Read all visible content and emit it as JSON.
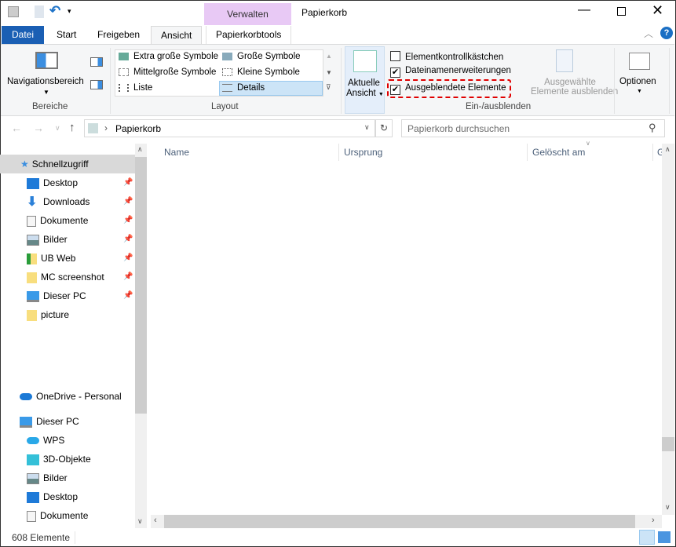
{
  "title": "Papierkorb",
  "context_tab": "Verwalten",
  "tabs": [
    {
      "label": "Datei"
    },
    {
      "label": "Start"
    },
    {
      "label": "Freigeben"
    },
    {
      "label": "Ansicht"
    },
    {
      "label": "Papierkorbtools"
    }
  ],
  "ribbon": {
    "bereiche": {
      "nav_label": "Navigationsbereich",
      "group": "Bereiche"
    },
    "layout": {
      "items": [
        "Extra große Symbole",
        "Große Symbole",
        "Mittelgroße Symbole",
        "Kleine Symbole",
        "Liste",
        "Details"
      ],
      "selected": "Details",
      "group": "Layout"
    },
    "current_view": {
      "line1": "Aktuelle",
      "line2": "Ansicht"
    },
    "show_hide": {
      "checkboxes": [
        {
          "label": "Elementkontrollkästchen",
          "checked": false
        },
        {
          "label": "Dateinamenerweiterungen",
          "checked": true
        },
        {
          "label": "Ausgeblendete Elemente",
          "checked": true
        }
      ],
      "hide_selected_1": "Ausgewählte",
      "hide_selected_2": "Elemente ausblenden",
      "group": "Ein-/ausblenden"
    },
    "options": "Optionen",
    "highlight_color": "#e00000"
  },
  "address": {
    "path": "Papierkorb",
    "search_placeholder": "Papierkorb durchsuchen"
  },
  "nav": {
    "quick_access": "Schnellzugriff",
    "quick_items": [
      {
        "label": "Desktop",
        "pinned": true
      },
      {
        "label": "Downloads",
        "pinned": true
      },
      {
        "label": "Dokumente",
        "pinned": true
      },
      {
        "label": "Bilder",
        "pinned": true
      },
      {
        "label": "UB Web",
        "pinned": true
      },
      {
        "label": "MC screenshot",
        "pinned": true
      },
      {
        "label": "Dieser PC",
        "pinned": true
      },
      {
        "label": "picture",
        "pinned": false
      }
    ],
    "onedrive": "OneDrive - Personal",
    "this_pc": "Dieser PC",
    "pc_items": [
      "WPS",
      "3D-Objekte",
      "Bilder",
      "Desktop",
      "Dokumente"
    ]
  },
  "columns": [
    "Name",
    "Ursprung",
    "Gelöscht am",
    "G"
  ],
  "status": {
    "count": "608 Elemente"
  }
}
